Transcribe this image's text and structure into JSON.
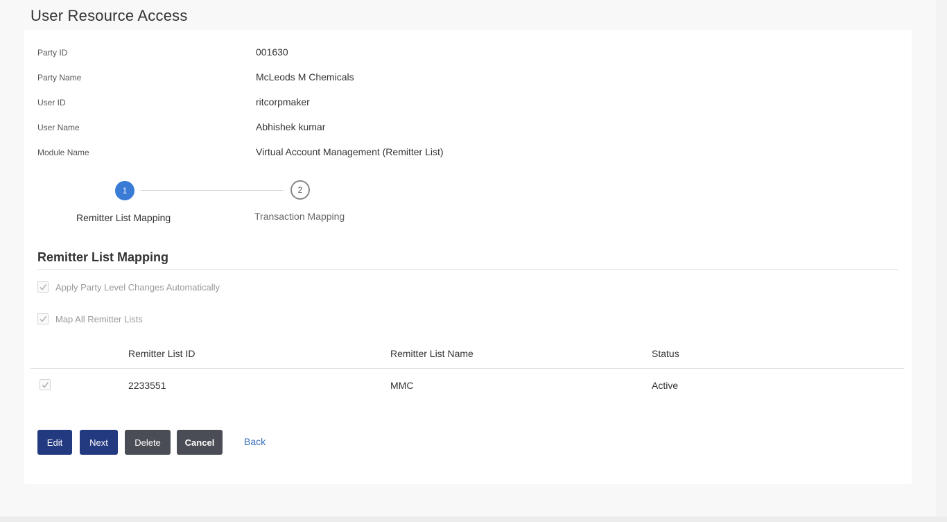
{
  "page": {
    "title": "User Resource Access"
  },
  "details": [
    {
      "label": "Party ID",
      "value": "001630"
    },
    {
      "label": "Party Name",
      "value": "McLeods M Chemicals"
    },
    {
      "label": "User ID",
      "value": "ritcorpmaker"
    },
    {
      "label": "User Name",
      "value": "Abhishek kumar"
    },
    {
      "label": "Module Name",
      "value": "Virtual Account Management (Remitter List)"
    }
  ],
  "stepper": {
    "steps": [
      {
        "number": "1",
        "label": "Remitter List Mapping",
        "state": "active"
      },
      {
        "number": "2",
        "label": "Transaction Mapping",
        "state": "pending"
      }
    ]
  },
  "section": {
    "title": "Remitter List Mapping",
    "options": [
      {
        "label": "Apply Party Level Changes Automatically",
        "checked": true,
        "disabled": true
      },
      {
        "label": "Map All Remitter Lists",
        "checked": true,
        "disabled": true
      }
    ]
  },
  "table": {
    "columns": [
      "Remitter List ID",
      "Remitter List Name",
      "Status"
    ],
    "rows": [
      {
        "checked": true,
        "id": "2233551",
        "name": "MMC",
        "status": "Active"
      }
    ]
  },
  "actions": {
    "edit_label": "Edit",
    "next_label": "Next",
    "delete_label": "Delete",
    "cancel_label": "Cancel",
    "back_label": "Back"
  },
  "colors": {
    "primary_button": "#243a80",
    "dark_button": "#4a4d55",
    "step_active": "#3a7bd5",
    "link": "#3a6fb5"
  }
}
